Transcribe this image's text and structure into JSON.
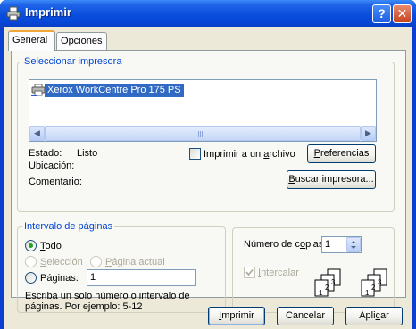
{
  "window": {
    "title": "Imprimir"
  },
  "tabs": [
    {
      "label": "General",
      "active": true
    },
    {
      "label": "Opciones",
      "active": false
    }
  ],
  "select_printer": {
    "legend": "Seleccionar impresora",
    "printers": [
      {
        "name": "Xerox WorkCentre Pro 175 PS",
        "selected": true
      }
    ],
    "status_label": "Estado:",
    "status_value": "Listo",
    "location_label": "Ubicación:",
    "location_value": "",
    "comment_label": "Comentario:",
    "comment_value": "",
    "print_to_file_label": "Imprimir a un archivo",
    "print_to_file_checked": false,
    "preferences_button": "Preferencias",
    "find_printer_button": "Buscar impresora..."
  },
  "page_range": {
    "legend": "Intervalo de páginas",
    "all_label": "Todo",
    "selection_label": "Selección",
    "current_page_label": "Página actual",
    "pages_label": "Páginas:",
    "pages_value": "1",
    "hint": [
      "Escriba un solo número o intervalo de",
      "páginas. Por ejemplo: 5-12"
    ]
  },
  "copies": {
    "label": "Número de copias:",
    "value": "1",
    "collate_label": "Intercalar",
    "collate_checked": true,
    "page_labels": [
      "1",
      "2",
      "3"
    ]
  },
  "buttons": {
    "print": "Imprimir",
    "cancel": "Cancelar",
    "apply": "Aplicar"
  },
  "icons": {
    "title": "printer-icon",
    "help": "help-icon",
    "close": "close-icon"
  },
  "colors": {
    "titlebar": "#0a4edd",
    "selection": "#316ac5",
    "legend_text": "#0046d5",
    "dialog_bg": "#ece9d8"
  }
}
